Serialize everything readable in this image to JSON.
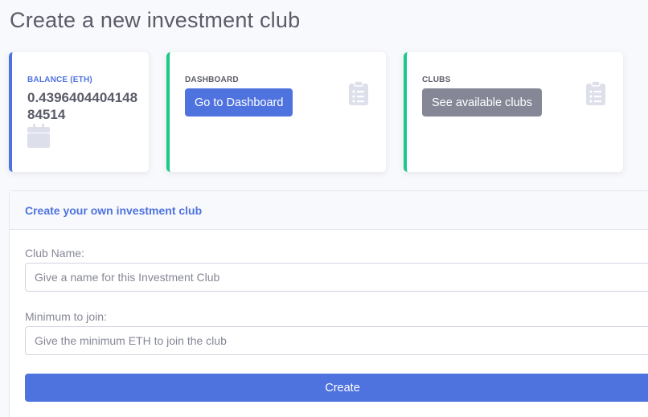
{
  "page": {
    "title": "Create a new investment club"
  },
  "cards": {
    "balance": {
      "label": "BALANCE (ETH)",
      "value": "0.439640440414884514",
      "icon": "calendar-icon"
    },
    "dashboard": {
      "label": "DASHBOARD",
      "button": "Go to Dashboard",
      "icon": "clipboard-list-icon"
    },
    "clubs": {
      "label": "CLUBS",
      "button": "See available clubs",
      "icon": "clipboard-list-icon"
    }
  },
  "form": {
    "header": "Create your own investment club",
    "club_name": {
      "label": "Club Name:",
      "placeholder": "Give a name for this Investment Club",
      "value": ""
    },
    "min_join": {
      "label": "Minimum to join:",
      "placeholder": "Give the minimum ETH to join the club",
      "value": ""
    },
    "submit": "Create"
  },
  "colors": {
    "primary": "#4e73df",
    "success": "#1cc88a",
    "secondary": "#858796",
    "icon": "#dddfeb",
    "text": "#5a5c69"
  }
}
